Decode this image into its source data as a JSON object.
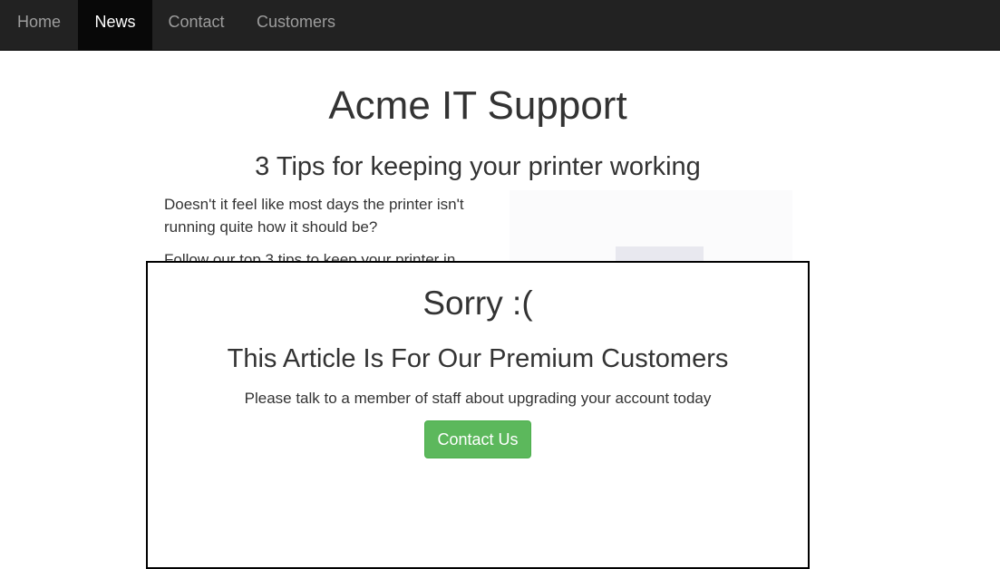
{
  "nav": {
    "items": [
      {
        "label": "Home",
        "active": false
      },
      {
        "label": "News",
        "active": true
      },
      {
        "label": "Contact",
        "active": false
      },
      {
        "label": "Customers",
        "active": false
      }
    ]
  },
  "site": {
    "title": "Acme IT Support"
  },
  "article": {
    "title": "3 Tips for keeping your printer working",
    "paragraphs": [
      "Doesn't it feel like most days the printer isn't running quite how it should be?",
      "Follow our top 3 tips to keep your printer in"
    ]
  },
  "paywall": {
    "sorry": "Sorry :(",
    "heading": "This Article Is For Our Premium Customers",
    "message": "Please talk to a member of staff about upgrading your account today",
    "button_label": "Contact Us"
  },
  "colors": {
    "navbar_bg": "#222222",
    "navbar_active_bg": "#080808",
    "button_green": "#5cb85c"
  }
}
